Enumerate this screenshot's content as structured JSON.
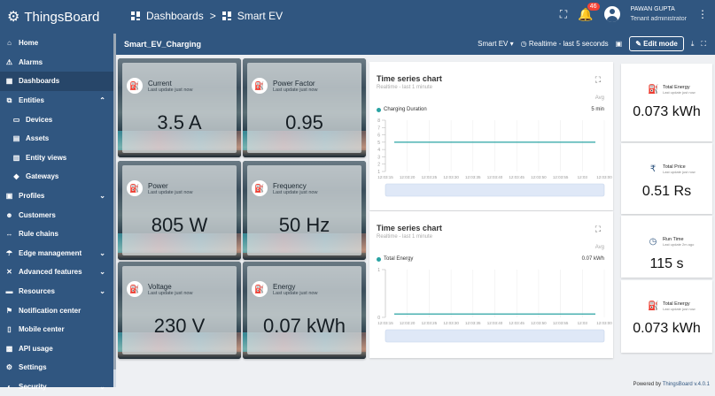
{
  "app": {
    "name": "ThingsBoard"
  },
  "breadcrumb": {
    "first": "Dashboards",
    "separator": ">",
    "second": "Smart EV"
  },
  "user": {
    "name": "PAWAN GUPTA",
    "role": "Tenant administrator",
    "notifications": "46"
  },
  "sidebar": {
    "items": [
      {
        "label": "Home",
        "icon": "home-icon"
      },
      {
        "label": "Alarms",
        "icon": "warning-icon"
      },
      {
        "label": "Dashboards",
        "icon": "dashboard-icon",
        "active": true
      },
      {
        "label": "Entities",
        "icon": "entities-icon",
        "expandable": true,
        "expanded": true
      },
      {
        "label": "Devices",
        "icon": "devices-icon",
        "sub": true
      },
      {
        "label": "Assets",
        "icon": "assets-icon",
        "sub": true
      },
      {
        "label": "Entity views",
        "icon": "entity-views-icon",
        "sub": true
      },
      {
        "label": "Gateways",
        "icon": "gateways-icon",
        "sub": true
      },
      {
        "label": "Profiles",
        "icon": "profiles-icon",
        "expandable": true
      },
      {
        "label": "Customers",
        "icon": "customers-icon"
      },
      {
        "label": "Rule chains",
        "icon": "rule-chains-icon"
      },
      {
        "label": "Edge management",
        "icon": "edge-icon",
        "expandable": true
      },
      {
        "label": "Advanced features",
        "icon": "advanced-icon",
        "expandable": true
      },
      {
        "label": "Resources",
        "icon": "resources-icon",
        "expandable": true
      },
      {
        "label": "Notification center",
        "icon": "notification-icon"
      },
      {
        "label": "Mobile center",
        "icon": "mobile-icon"
      },
      {
        "label": "API usage",
        "icon": "api-usage-icon"
      },
      {
        "label": "Settings",
        "icon": "settings-icon"
      },
      {
        "label": "Security",
        "icon": "security-icon",
        "expandable": true
      }
    ]
  },
  "dashboard": {
    "title": "Smart_EV_Charging",
    "state_select": "Smart EV",
    "timewindow": "Realtime - last 5 seconds",
    "edit_label": "Edit mode"
  },
  "tiles": [
    {
      "label": "Current",
      "sub": "Last update just now",
      "value": "3.5 A",
      "icon": "ev-station-icon"
    },
    {
      "label": "Power Factor",
      "sub": "Last update just now",
      "value": "0.95",
      "icon": "ev-station-icon"
    },
    {
      "label": "Power",
      "sub": "Last update just now",
      "value": "805 W",
      "icon": "ev-station-icon"
    },
    {
      "label": "Frequency",
      "sub": "Last update just now",
      "value": "50 Hz",
      "icon": "ev-station-icon"
    },
    {
      "label": "Voltage",
      "sub": "Last update just now",
      "value": "230 V",
      "icon": "ev-station-icon"
    },
    {
      "label": "Energy",
      "sub": "Last update just now",
      "value": "0.07 kWh",
      "icon": "ev-station-icon"
    }
  ],
  "charts": [
    {
      "title": "Time series chart",
      "subtitle": "Realtime - last 1 minute",
      "agg": "Avg",
      "legend": "Charging Duration",
      "legend_value": "5 min",
      "color": "#29a3a3",
      "chart_data": {
        "type": "line",
        "y_ticks": [
          "1",
          "2",
          "3",
          "4",
          "5",
          "6",
          "7",
          "8"
        ],
        "ylim": [
          1,
          8
        ],
        "x_ticks": [
          "12:03:15",
          "12:03:20",
          "12:03:25",
          "12:03:30",
          "12:03:35",
          "12:03:40",
          "12:03:45",
          "12:03:50",
          "12:03:55",
          "12:03",
          "12:03:00"
        ],
        "series": [
          {
            "name": "Charging Duration",
            "values": [
              5,
              5,
              5,
              5,
              5,
              5,
              5,
              5,
              5,
              5,
              5
            ]
          }
        ]
      }
    },
    {
      "title": "Time series chart",
      "subtitle": "Realtime - last 1 minute",
      "agg": "Avg",
      "legend": "Total Energy",
      "legend_value": "0.07 kWh",
      "color": "#29a3a3",
      "chart_data": {
        "type": "line",
        "y_ticks": [
          "0",
          "1"
        ],
        "ylim": [
          0,
          1
        ],
        "x_ticks": [
          "12:03:15",
          "12:03:20",
          "12:03:25",
          "12:03:30",
          "12:03:35",
          "12:03:40",
          "12:03:45",
          "12:03:50",
          "12:03:55",
          "12:03",
          "12:03:00"
        ],
        "series": [
          {
            "name": "Total Energy",
            "values": [
              0.07,
              0.07,
              0.07,
              0.07,
              0.07,
              0.07,
              0.07,
              0.07,
              0.07,
              0.07,
              0.07
            ]
          }
        ]
      }
    }
  ],
  "kpis": [
    {
      "label": "Total Energy",
      "sub": "Last update just now",
      "value": "0.073 kWh",
      "icon": "ev-station-icon"
    },
    {
      "label": "Total Price",
      "sub": "Last update just now",
      "value": "0.51 Rs",
      "icon": "rupee-icon"
    },
    {
      "label": "Run Time",
      "sub": "Last update 2m ago",
      "value": "115 s",
      "icon": "clock-icon"
    },
    {
      "label": "Total Energy",
      "sub": "Last update just now",
      "value": "0.073 kWh",
      "icon": "ev-station-icon"
    }
  ],
  "footer": {
    "powered": "Powered by",
    "brand": "ThingsBoard v.4.0.1"
  }
}
